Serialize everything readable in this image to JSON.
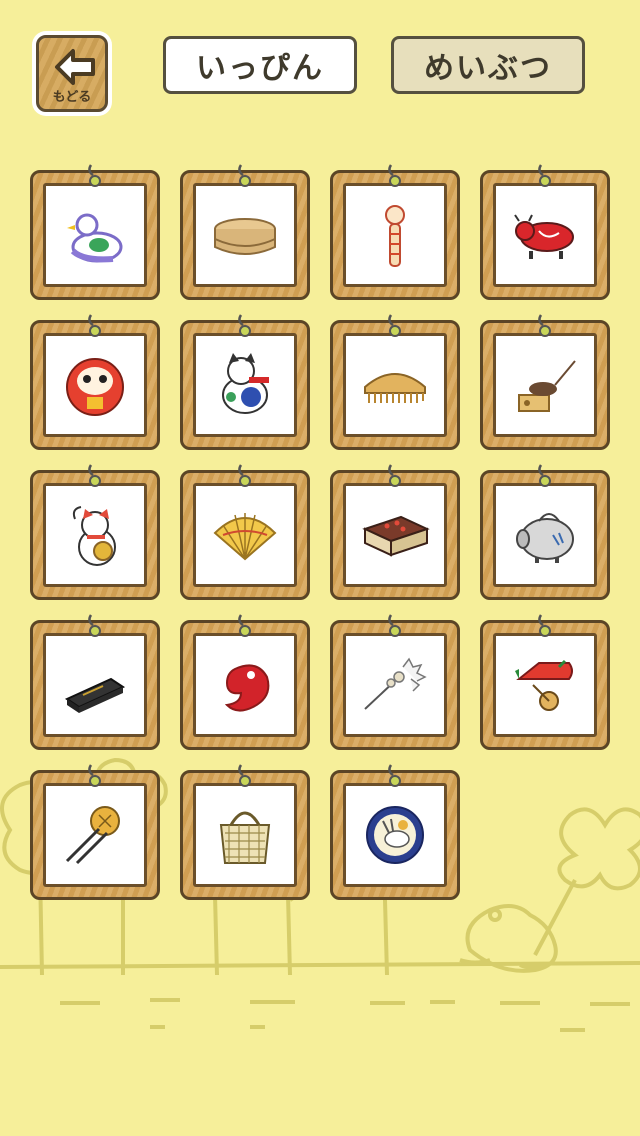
{
  "header": {
    "back_label": "もどる",
    "tabs": [
      {
        "label": "いっぴん",
        "selected": true
      },
      {
        "label": "めいぶつ",
        "selected": false
      }
    ]
  },
  "items": [
    {
      "icon": "pigeon-whistle-icon"
    },
    {
      "icon": "bento-box-icon"
    },
    {
      "icon": "kokeshi-doll-icon"
    },
    {
      "icon": "red-cow-icon"
    },
    {
      "icon": "daruma-icon"
    },
    {
      "icon": "inu-hariko-icon"
    },
    {
      "icon": "wooden-comb-icon"
    },
    {
      "icon": "mouse-trap-icon"
    },
    {
      "icon": "maneki-neko-icon"
    },
    {
      "icon": "folding-fan-icon"
    },
    {
      "icon": "matchbox-icon"
    },
    {
      "icon": "boar-mosquito-pot-icon"
    },
    {
      "icon": "inkstick-icon"
    },
    {
      "icon": "magatama-icon"
    },
    {
      "icon": "hairpin-icon"
    },
    {
      "icon": "sea-bream-cart-icon"
    },
    {
      "icon": "kanzashi-icon"
    },
    {
      "icon": "bamboo-basket-icon"
    },
    {
      "icon": "rabbit-plate-icon"
    }
  ],
  "colors": {
    "background": "#f6ef9a",
    "wood": "#d7a557",
    "frame": "#5b4526"
  }
}
